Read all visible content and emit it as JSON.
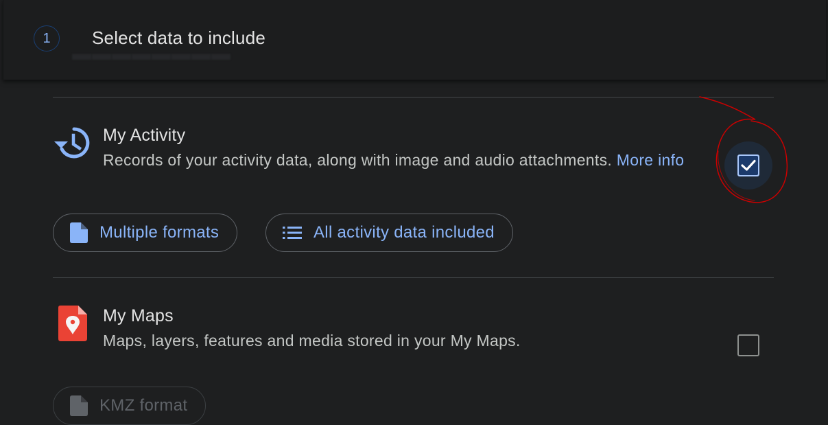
{
  "step": {
    "number": "1",
    "title": "Select data to include"
  },
  "products": [
    {
      "name": "My Activity",
      "description": "Records of your activity data, along with image and audio attachments.",
      "more_link": "More info",
      "checked": true,
      "icon": "history-icon",
      "chips": [
        {
          "label": "Multiple formats",
          "icon": "file-icon"
        },
        {
          "label": "All activity data included",
          "icon": "list-icon"
        }
      ]
    },
    {
      "name": "My Maps",
      "description": "Maps, layers, features and media stored in your My Maps.",
      "checked": false,
      "icon": "my-maps-icon",
      "chips": [
        {
          "label": "KMZ format",
          "icon": "file-icon"
        }
      ]
    }
  ],
  "colors": {
    "accent": "#8ab4f8",
    "annotation": "#cc0000",
    "maps_red": "#ea4335"
  }
}
